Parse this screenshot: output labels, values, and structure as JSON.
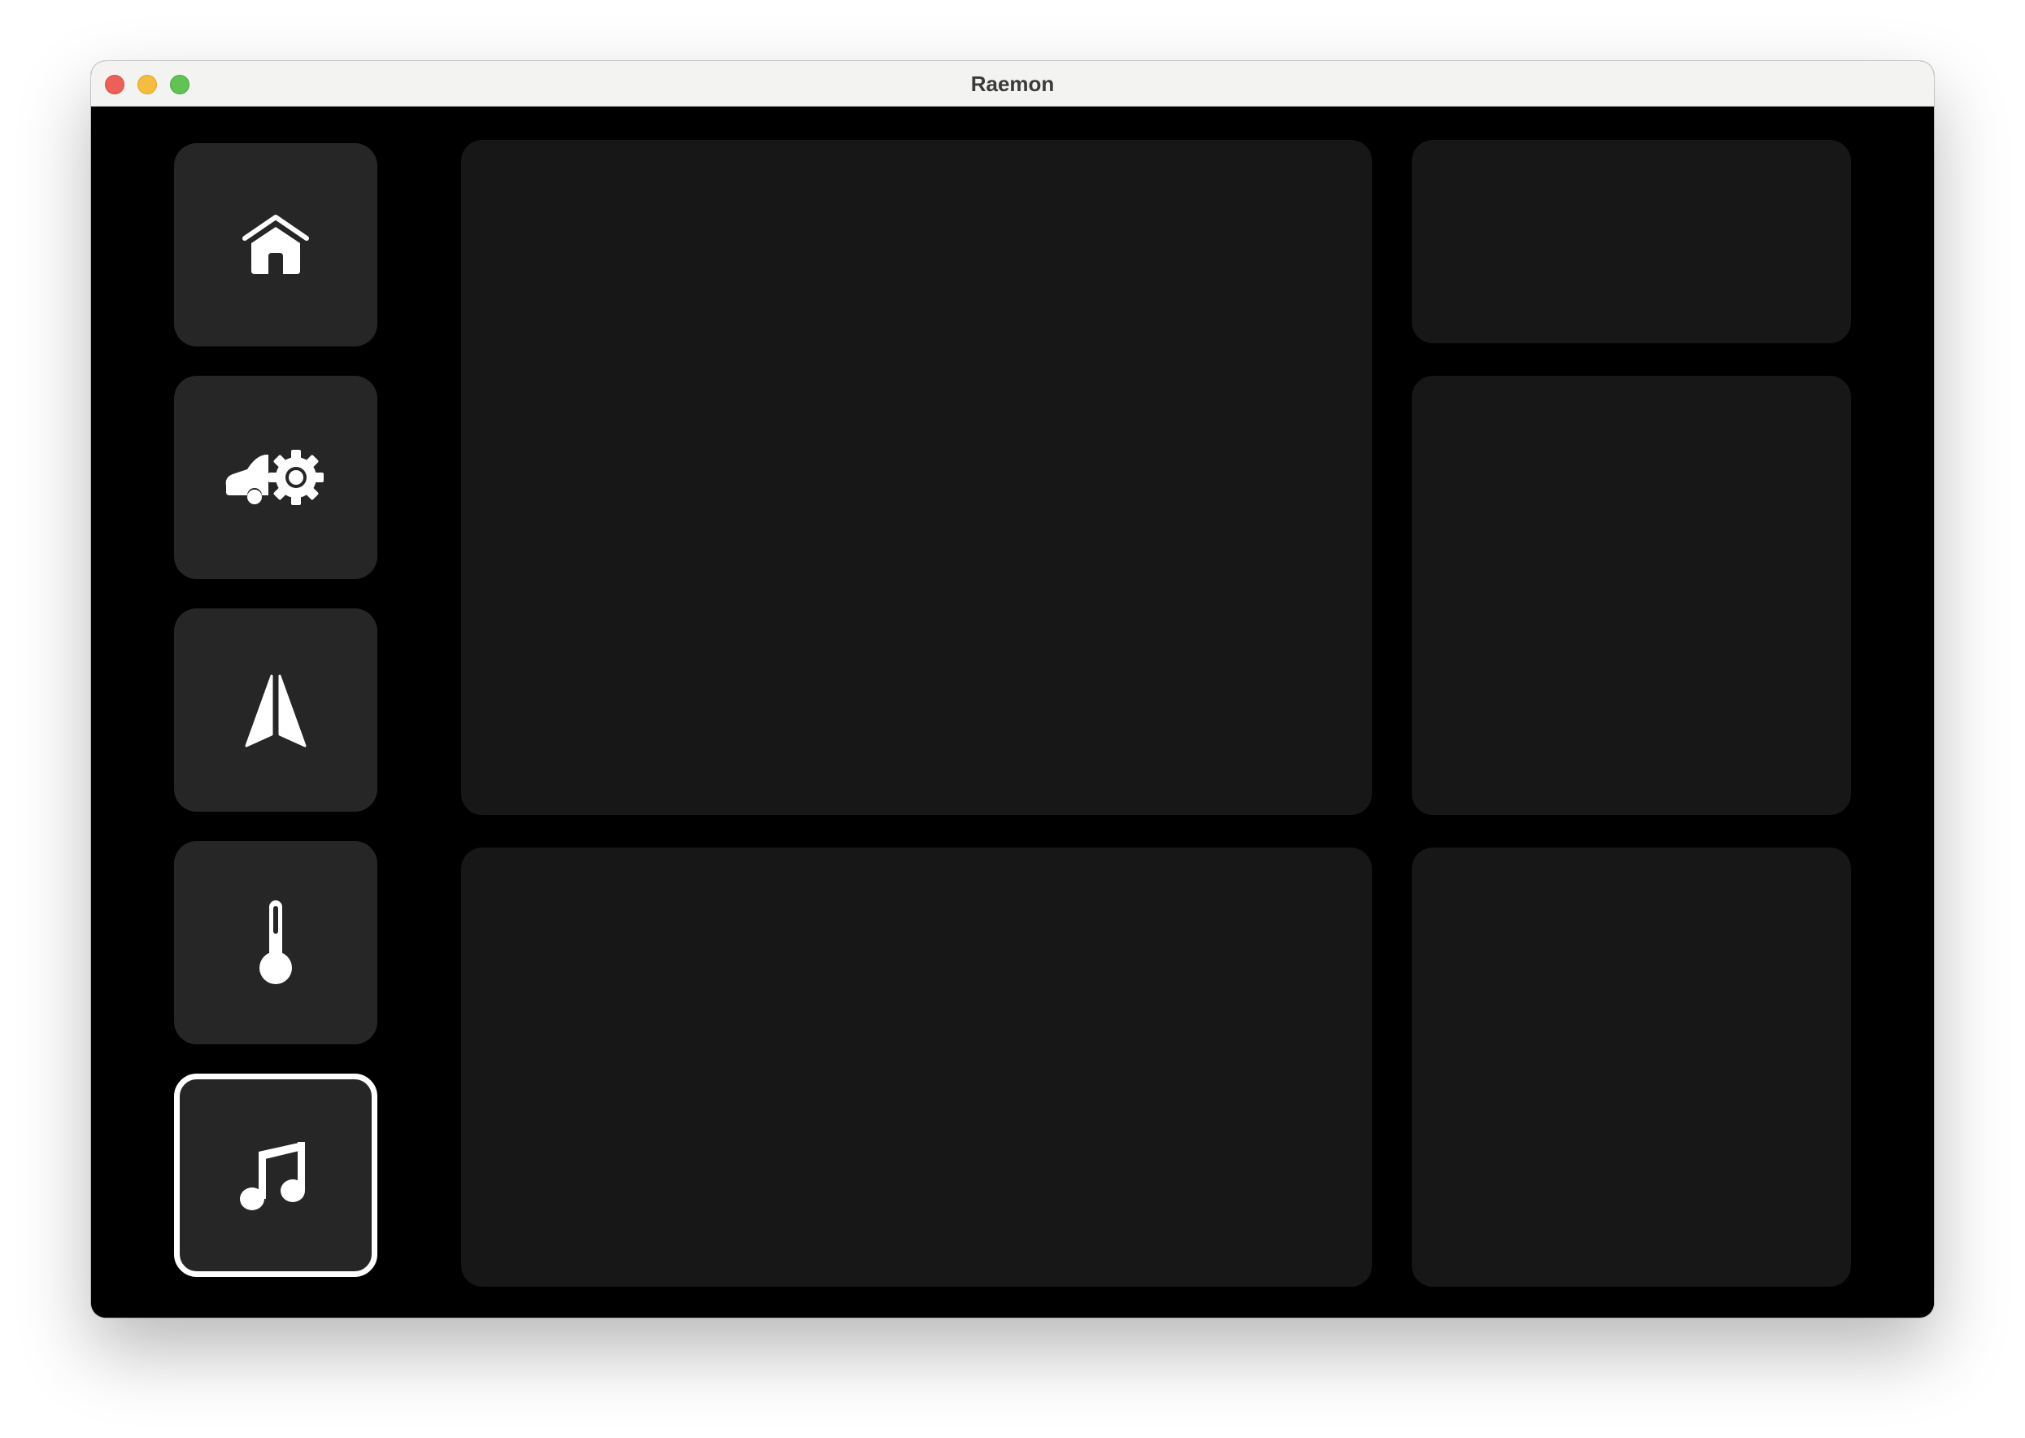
{
  "window": {
    "title": "Raemon"
  },
  "sidebar": {
    "items": [
      {
        "id": "home",
        "icon": "home-icon",
        "active": false
      },
      {
        "id": "car-settings",
        "icon": "car-gear-icon",
        "active": false
      },
      {
        "id": "navigation",
        "icon": "navigation-arrow-icon",
        "active": false
      },
      {
        "id": "climate",
        "icon": "thermometer-icon",
        "active": false
      },
      {
        "id": "music",
        "icon": "music-note-icon",
        "active": true
      }
    ]
  },
  "colors": {
    "background": "#000000",
    "nav_button": "#262626",
    "panel": "#171717",
    "active_border": "#ffffff",
    "icon": "#ffffff"
  }
}
